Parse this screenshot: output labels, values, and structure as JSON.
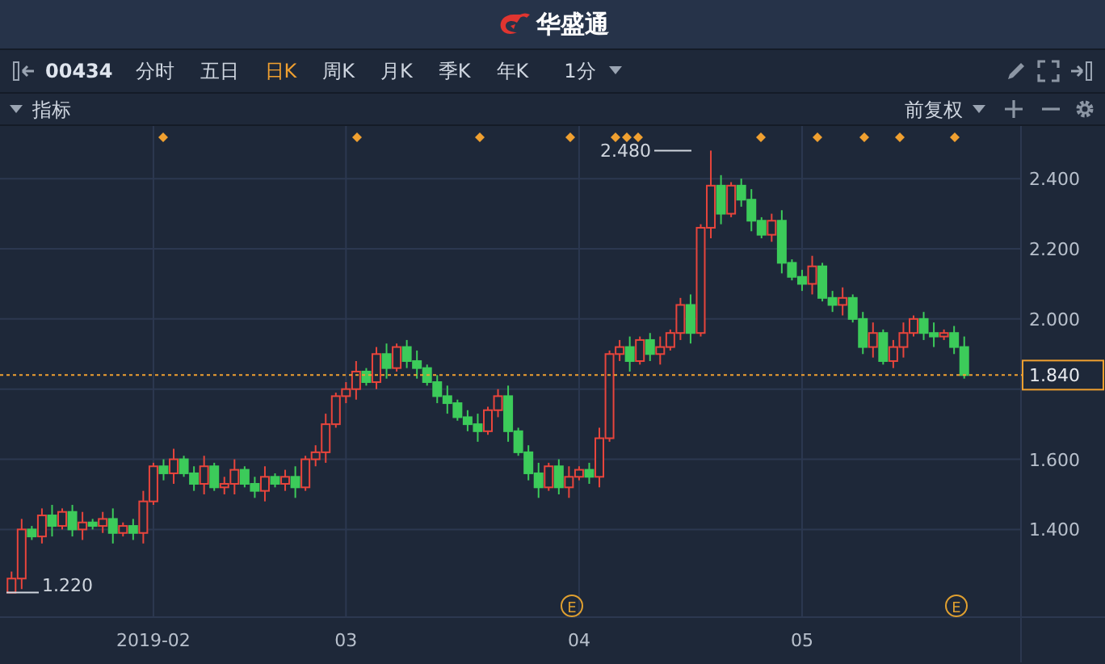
{
  "app": {
    "title": "华盛通"
  },
  "toolbar": {
    "stock_code": "00434",
    "periods": [
      {
        "label": "分时",
        "selected": false
      },
      {
        "label": "五日",
        "selected": false
      },
      {
        "label": "日K",
        "selected": true
      },
      {
        "label": "周K",
        "selected": false
      },
      {
        "label": "月K",
        "selected": false
      },
      {
        "label": "季K",
        "selected": false
      },
      {
        "label": "年K",
        "selected": false
      }
    ],
    "interval": "1分"
  },
  "indicator_bar": {
    "label": "指标",
    "adjustment": "前复权"
  },
  "chart": {
    "high_label": "2.480",
    "low_label": "1.220",
    "event_markers": [
      "E",
      "E"
    ],
    "chart_data": {
      "type": "candlestick",
      "ylim": [
        1.15,
        2.55
      ],
      "grid": true,
      "ref_lines": [
        {
          "axis": "y",
          "value": 1.84,
          "label": "1.840",
          "color": "#f0a030"
        }
      ],
      "yticks": [
        {
          "value": 2.4,
          "label": "2.400"
        },
        {
          "value": 2.2,
          "label": "2.200"
        },
        {
          "value": 2.0,
          "label": "2.000"
        },
        {
          "value": 1.6,
          "label": "1.600"
        },
        {
          "value": 1.4,
          "label": "1.400"
        }
      ],
      "categories": [
        null,
        null,
        null,
        null,
        null,
        null,
        null,
        null,
        null,
        null,
        null,
        null,
        null,
        null,
        "2019-02",
        null,
        null,
        null,
        null,
        null,
        null,
        null,
        null,
        null,
        null,
        null,
        null,
        null,
        null,
        null,
        null,
        null,
        null,
        "03",
        null,
        null,
        null,
        null,
        null,
        null,
        null,
        null,
        null,
        null,
        null,
        null,
        null,
        null,
        null,
        null,
        null,
        null,
        null,
        null,
        null,
        null,
        "04",
        null,
        null,
        null,
        null,
        null,
        null,
        null,
        null,
        null,
        null,
        null,
        null,
        null,
        null,
        null,
        null,
        null,
        null,
        null,
        null,
        null,
        "05",
        null,
        null,
        null,
        null,
        null,
        null,
        null,
        null,
        null,
        null,
        null,
        null,
        null,
        null,
        null,
        null
      ],
      "ohlc": [
        [
          1.22,
          1.28,
          1.22,
          1.26
        ],
        [
          1.26,
          1.43,
          1.23,
          1.4
        ],
        [
          1.4,
          1.41,
          1.37,
          1.38
        ],
        [
          1.38,
          1.46,
          1.36,
          1.44
        ],
        [
          1.44,
          1.47,
          1.38,
          1.41
        ],
        [
          1.41,
          1.46,
          1.4,
          1.45
        ],
        [
          1.45,
          1.47,
          1.38,
          1.4
        ],
        [
          1.4,
          1.45,
          1.37,
          1.42
        ],
        [
          1.42,
          1.43,
          1.4,
          1.41
        ],
        [
          1.41,
          1.45,
          1.39,
          1.43
        ],
        [
          1.43,
          1.46,
          1.36,
          1.39
        ],
        [
          1.39,
          1.42,
          1.38,
          1.41
        ],
        [
          1.41,
          1.43,
          1.37,
          1.39
        ],
        [
          1.39,
          1.51,
          1.36,
          1.48
        ],
        [
          1.48,
          1.59,
          1.47,
          1.58
        ],
        [
          1.58,
          1.6,
          1.54,
          1.56
        ],
        [
          1.56,
          1.63,
          1.53,
          1.6
        ],
        [
          1.6,
          1.61,
          1.55,
          1.56
        ],
        [
          1.56,
          1.58,
          1.51,
          1.53
        ],
        [
          1.53,
          1.61,
          1.5,
          1.58
        ],
        [
          1.58,
          1.59,
          1.51,
          1.52
        ],
        [
          1.52,
          1.55,
          1.5,
          1.53
        ],
        [
          1.53,
          1.6,
          1.5,
          1.57
        ],
        [
          1.57,
          1.58,
          1.52,
          1.53
        ],
        [
          1.53,
          1.55,
          1.49,
          1.51
        ],
        [
          1.51,
          1.58,
          1.48,
          1.55
        ],
        [
          1.55,
          1.56,
          1.52,
          1.53
        ],
        [
          1.53,
          1.57,
          1.51,
          1.55
        ],
        [
          1.55,
          1.58,
          1.49,
          1.52
        ],
        [
          1.52,
          1.61,
          1.51,
          1.6
        ],
        [
          1.6,
          1.64,
          1.58,
          1.62
        ],
        [
          1.62,
          1.73,
          1.59,
          1.7
        ],
        [
          1.7,
          1.79,
          1.69,
          1.78
        ],
        [
          1.78,
          1.82,
          1.76,
          1.8
        ],
        [
          1.8,
          1.88,
          1.77,
          1.85
        ],
        [
          1.85,
          1.86,
          1.81,
          1.82
        ],
        [
          1.82,
          1.92,
          1.8,
          1.9
        ],
        [
          1.9,
          1.93,
          1.83,
          1.86
        ],
        [
          1.86,
          1.93,
          1.85,
          1.92
        ],
        [
          1.92,
          1.94,
          1.86,
          1.88
        ],
        [
          1.88,
          1.91,
          1.83,
          1.86
        ],
        [
          1.86,
          1.87,
          1.81,
          1.82
        ],
        [
          1.82,
          1.84,
          1.76,
          1.78
        ],
        [
          1.78,
          1.81,
          1.73,
          1.76
        ],
        [
          1.76,
          1.77,
          1.71,
          1.72
        ],
        [
          1.72,
          1.74,
          1.68,
          1.7
        ],
        [
          1.7,
          1.73,
          1.65,
          1.68
        ],
        [
          1.68,
          1.75,
          1.67,
          1.74
        ],
        [
          1.74,
          1.8,
          1.72,
          1.78
        ],
        [
          1.78,
          1.81,
          1.65,
          1.68
        ],
        [
          1.68,
          1.69,
          1.61,
          1.62
        ],
        [
          1.62,
          1.64,
          1.54,
          1.56
        ],
        [
          1.56,
          1.59,
          1.49,
          1.52
        ],
        [
          1.52,
          1.59,
          1.51,
          1.58
        ],
        [
          1.58,
          1.6,
          1.5,
          1.52
        ],
        [
          1.52,
          1.58,
          1.49,
          1.55
        ],
        [
          1.55,
          1.58,
          1.54,
          1.57
        ],
        [
          1.57,
          1.59,
          1.53,
          1.55
        ],
        [
          1.55,
          1.69,
          1.52,
          1.66
        ],
        [
          1.66,
          1.91,
          1.65,
          1.9
        ],
        [
          1.9,
          1.94,
          1.88,
          1.92
        ],
        [
          1.92,
          1.95,
          1.85,
          1.88
        ],
        [
          1.88,
          1.95,
          1.87,
          1.94
        ],
        [
          1.94,
          1.96,
          1.88,
          1.9
        ],
        [
          1.9,
          1.95,
          1.87,
          1.92
        ],
        [
          1.92,
          1.97,
          1.91,
          1.96
        ],
        [
          1.96,
          2.06,
          1.94,
          2.04
        ],
        [
          2.04,
          2.07,
          1.93,
          1.96
        ],
        [
          1.96,
          2.27,
          1.95,
          2.26
        ],
        [
          2.26,
          2.48,
          2.23,
          2.38
        ],
        [
          2.38,
          2.41,
          2.27,
          2.3
        ],
        [
          2.3,
          2.39,
          2.29,
          2.38
        ],
        [
          2.38,
          2.4,
          2.32,
          2.34
        ],
        [
          2.34,
          2.37,
          2.25,
          2.28
        ],
        [
          2.28,
          2.29,
          2.23,
          2.24
        ],
        [
          2.24,
          2.3,
          2.22,
          2.28
        ],
        [
          2.28,
          2.31,
          2.13,
          2.16
        ],
        [
          2.16,
          2.17,
          2.11,
          2.12
        ],
        [
          2.12,
          2.14,
          2.08,
          2.1
        ],
        [
          2.1,
          2.18,
          2.07,
          2.15
        ],
        [
          2.15,
          2.16,
          2.05,
          2.06
        ],
        [
          2.06,
          2.08,
          2.02,
          2.04
        ],
        [
          2.04,
          2.09,
          2.01,
          2.06
        ],
        [
          2.06,
          2.07,
          1.99,
          2.0
        ],
        [
          2.0,
          2.02,
          1.9,
          1.92
        ],
        [
          1.92,
          1.99,
          1.89,
          1.96
        ],
        [
          1.96,
          1.97,
          1.87,
          1.88
        ],
        [
          1.88,
          1.94,
          1.86,
          1.92
        ],
        [
          1.92,
          1.99,
          1.89,
          1.96
        ],
        [
          1.96,
          2.01,
          1.95,
          2.0
        ],
        [
          2.0,
          2.02,
          1.94,
          1.96
        ],
        [
          1.96,
          1.99,
          1.92,
          1.95
        ],
        [
          1.95,
          1.97,
          1.94,
          1.96
        ],
        [
          1.96,
          1.98,
          1.9,
          1.92
        ],
        [
          1.92,
          1.95,
          1.83,
          1.84
        ]
      ]
    }
  }
}
